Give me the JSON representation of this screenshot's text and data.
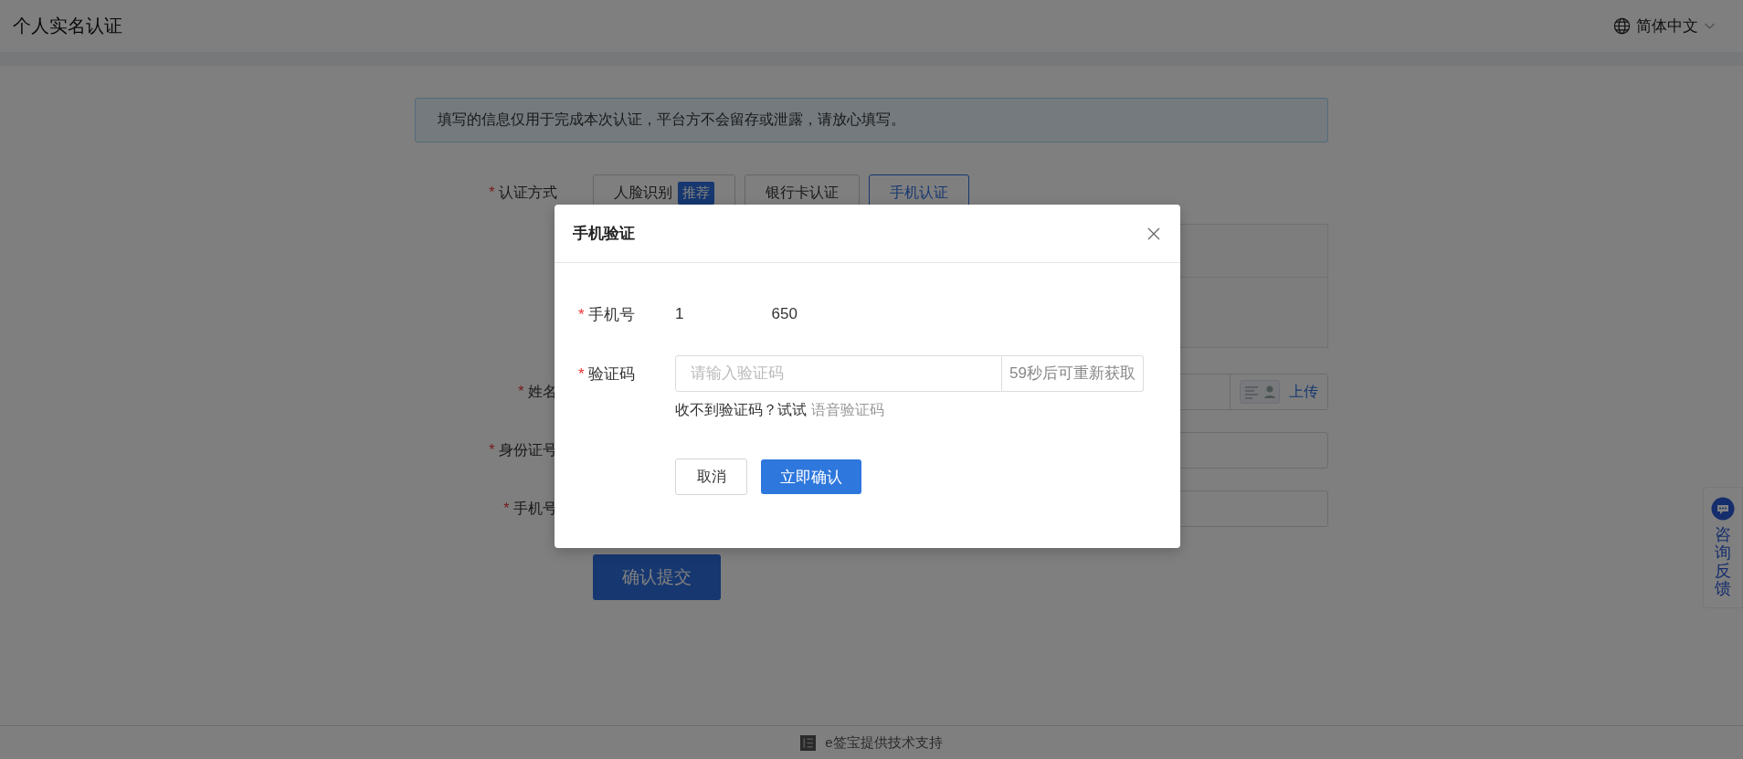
{
  "header": {
    "title": "个人实名认证",
    "language": "简体中文"
  },
  "notice": "填写的信息仅用于完成本次认证，平台方不会留存或泄露，请放心填写。",
  "form": {
    "method_mark": "*",
    "method_label": "认证方式",
    "methods": [
      {
        "label": "人脸识别",
        "badge": "推荐",
        "selected": false
      },
      {
        "label": "银行卡认证",
        "selected": false
      },
      {
        "label": "手机认证",
        "selected": true
      }
    ],
    "fields": [
      {
        "mark": "*",
        "label": "姓名",
        "kind": "upload",
        "action": "上传"
      },
      {
        "mark": "*",
        "label": "身份证号",
        "kind": "text"
      },
      {
        "mark": "*",
        "label": "手机号",
        "kind": "text"
      }
    ],
    "submit": "确认提交"
  },
  "dialog": {
    "title": "手机验证",
    "phone_mark": "*",
    "phone_label": "手机号",
    "phone_start": "1",
    "phone_end": "650",
    "code_mark": "*",
    "code_label": "验证码",
    "code_placeholder": "请输入验证码",
    "resend": "59秒后可重新获取",
    "hint": "收不到验证码？试试",
    "voice_link": "语音验证码",
    "cancel": "取消",
    "confirm": "立即确认"
  },
  "feedback": "咨询反馈",
  "footer": "e签宝提供技术支持"
}
